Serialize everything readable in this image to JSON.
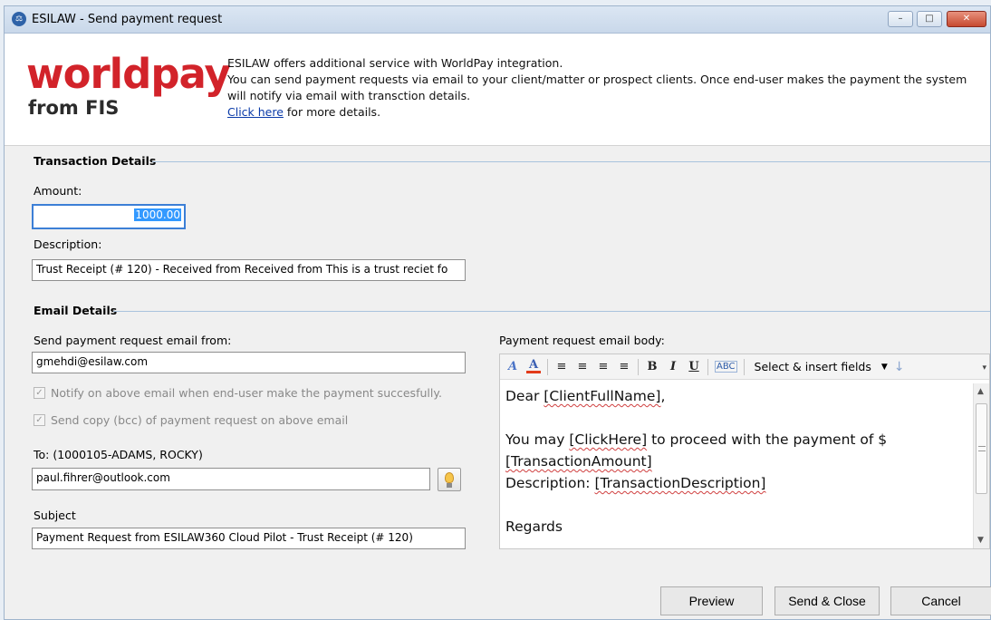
{
  "window": {
    "title": "ESILAW - Send payment request",
    "icon": "esilaw-scales-icon",
    "controls": {
      "minimize": "–",
      "maximize": "□",
      "close": "✕"
    }
  },
  "banner": {
    "logo_main": "worldpay",
    "logo_sub": "from FIS",
    "line1": "ESILAW offers additional service with WorldPay integration.",
    "line2": "You can send payment requests via email to your client/matter or prospect clients. Once end-user makes the payment the system will notify via email with transction details.",
    "link": "Click here",
    "link_suffix": " for more details.",
    "brand_color": "#d2232a"
  },
  "transaction": {
    "section_title": "Transaction Details",
    "amount_label": "Amount:",
    "amount_value": "1000.00",
    "description_label": "Description:",
    "description_value": "Trust Receipt (# 120) - Received from Received from This is a trust reciet fo"
  },
  "email": {
    "section_title": "Email Details",
    "from_label": "Send payment request email from:",
    "from_value": "gmehdi@esilaw.com",
    "notify_label": "Notify on above email when end-user make the payment succesfully.",
    "notify_checked": true,
    "bcc_label": "Send copy (bcc) of payment request on above email",
    "bcc_checked": true,
    "to_label": "To: (1000105-ADAMS, ROCKY)",
    "to_value": "paul.fihrer@outlook.com",
    "subject_label": "Subject",
    "subject_value": "Payment Request from ESILAW360 Cloud Pilot - Trust Receipt (# 120)"
  },
  "body_editor": {
    "label": "Payment request email body:",
    "toolbar": {
      "font_style": "A",
      "font_color": "A",
      "align_left": "≡",
      "align_center": "≡",
      "align_right": "≡",
      "justify": "≡",
      "bold": "B",
      "italic": "I",
      "underline": "U",
      "spellcheck": "ABC",
      "insert_fields": "Select & insert fields",
      "dropdown_caret": "▼",
      "insert_arrow": "↓",
      "overflow": "▾"
    },
    "lines": {
      "greeting_prefix": "Dear ",
      "greeting_field": "[ClientFullName]",
      "greeting_suffix": ",",
      "pay_prefix": "You may ",
      "pay_field": "[ClickHere]",
      "pay_suffix": " to proceed with the payment of $",
      "amount_field": "[TransactionAmount]",
      "desc_prefix": "Description: ",
      "desc_field": "[TransactionDescription]",
      "regards": "Regards"
    }
  },
  "buttons": {
    "preview": "Preview",
    "send_close": "Send & Close",
    "cancel": "Cancel"
  }
}
